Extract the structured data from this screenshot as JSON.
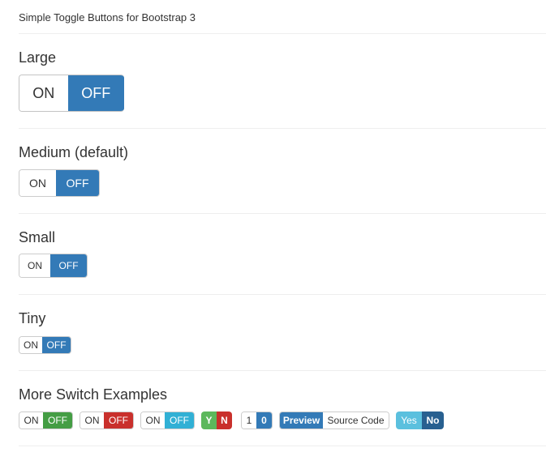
{
  "page": {
    "title": "Simple Toggle Buttons for Bootstrap 3"
  },
  "sections": {
    "large": {
      "title": "Large",
      "on_label": "ON",
      "off_label": "OFF",
      "state": "off"
    },
    "medium": {
      "title": "Medium (default)",
      "on_label": "ON",
      "off_label": "OFF",
      "state": "off"
    },
    "small": {
      "title": "Small",
      "on_label": "ON",
      "off_label": "OFF",
      "state": "off"
    },
    "tiny": {
      "title": "Tiny",
      "on_label": "ON",
      "off_label": "OFF",
      "state": "off"
    },
    "more": {
      "title": "More Switch Examples",
      "examples": [
        {
          "on_label": "ON",
          "off_label": "OFF",
          "style": "success",
          "color": "#449d44",
          "state": "off"
        },
        {
          "on_label": "ON",
          "off_label": "OFF",
          "style": "danger",
          "color": "#c9302c",
          "state": "off"
        },
        {
          "on_label": "ON",
          "off_label": "OFF",
          "style": "info",
          "color": "#31b0d5",
          "state": "off"
        },
        {
          "on_label": "Y",
          "off_label": "N",
          "on_color": "#5cb85c",
          "off_color": "#c9302c",
          "state": "off"
        },
        {
          "on_label": "1",
          "off_label": "0",
          "style": "primary",
          "color": "#337ab7",
          "state": "off"
        },
        {
          "on_label": "Preview",
          "off_label": "Source Code",
          "style": "primary",
          "color": "#337ab7",
          "state": "on"
        },
        {
          "on_label": "Yes",
          "off_label": "No",
          "on_color": "#5bc0de",
          "off_color": "#286090",
          "state": "off"
        }
      ]
    }
  },
  "colors": {
    "primary": "#337ab7",
    "text": "#333333",
    "divider": "#eeeeee",
    "border": "#cccccc"
  }
}
